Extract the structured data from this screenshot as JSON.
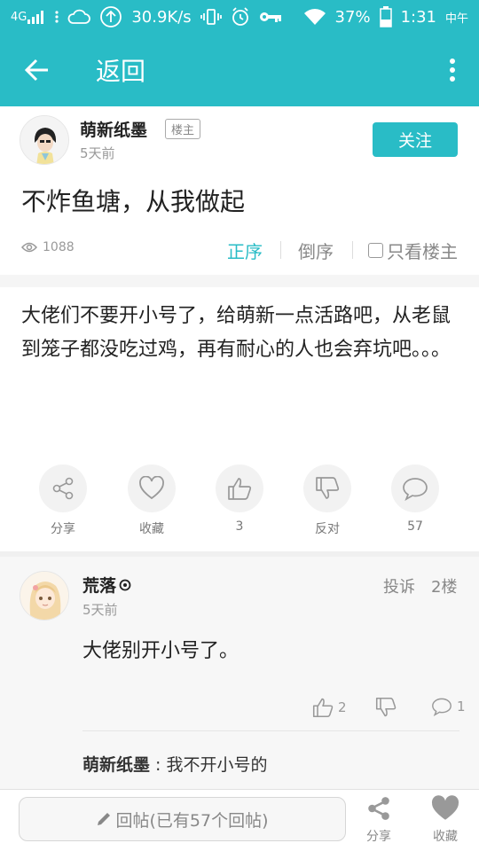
{
  "status_bar": {
    "network": "4G",
    "speed": "30.9K/s",
    "battery": "37%",
    "time": "1:31",
    "time_suffix": "中午"
  },
  "app_bar": {
    "back_label": "返回"
  },
  "post": {
    "author": {
      "name": "萌新纸墨",
      "badge": "楼主",
      "time": "5天前",
      "follow_label": "关注"
    },
    "title": "不炸鱼塘，从我做起",
    "views": "1088",
    "sort_asc": "正序",
    "sort_desc": "倒序",
    "only_op": "只看楼主",
    "body": "大佬们不要开小号了，给萌新一点活路吧，从老鼠到笼子都没吃过鸡，再有耐心的人也会弃坑吧。。。",
    "actions": [
      {
        "label": "分享",
        "icon": "share-icon"
      },
      {
        "label": "收藏",
        "icon": "heart-icon"
      },
      {
        "label": "3",
        "icon": "thumbs-up-icon"
      },
      {
        "label": "反对",
        "icon": "thumbs-down-icon"
      },
      {
        "label": "57",
        "icon": "comment-icon"
      }
    ]
  },
  "comment": {
    "author": "荒落",
    "time": "5天前",
    "report": "投诉",
    "floor": "2楼",
    "text": "大佬别开小号了。",
    "likes": "2",
    "replies": "1",
    "reply": {
      "author": "萌新纸墨",
      "separator": " : ",
      "text": "我不开小号的"
    }
  },
  "bottom_bar": {
    "reply_placeholder": "回帖(已有57个回帖)",
    "share_label": "分享",
    "fav_label": "收藏"
  },
  "colors": {
    "accent": "#29bcc6"
  }
}
